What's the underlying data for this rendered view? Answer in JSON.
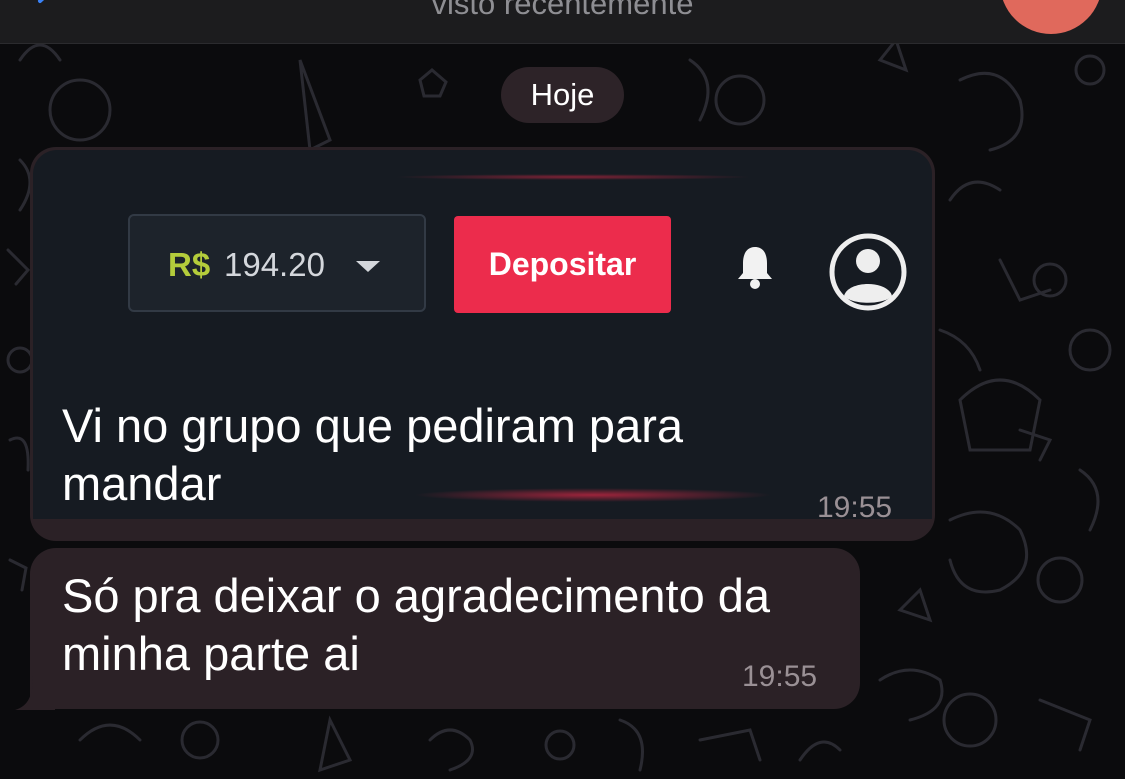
{
  "header": {
    "back_icon": "chevron-left-icon",
    "status": "visto recentemente",
    "avatar_color": "#e0695c"
  },
  "date_separator": "Hoje",
  "messages": [
    {
      "image": {
        "balance_currency": "R$",
        "balance_amount": "194.20",
        "dropdown_icon": "caret-down-icon",
        "deposit_label": "Depositar",
        "deposit_color": "#ec2c4c",
        "notifications_icon": "bell-icon",
        "profile_icon": "user-circle-icon"
      },
      "text": "Vi no grupo que pediram para mandar",
      "time": "19:55"
    },
    {
      "text": "Só pra deixar o agradecimento da minha parte ai",
      "time": "19:55"
    }
  ],
  "theme": {
    "background": "#0b0b0d",
    "bubble": "#2b2126",
    "time_text": "#9a9095"
  }
}
